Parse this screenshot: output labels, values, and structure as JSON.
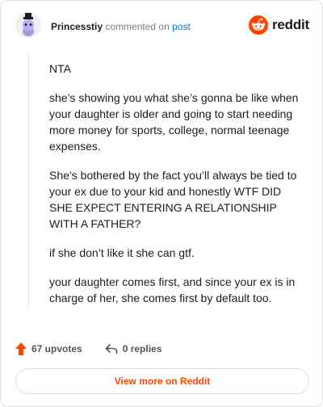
{
  "header": {
    "username": "Princesstiy",
    "action_text": "commented on",
    "post_link": "post",
    "brand": "reddit"
  },
  "comment": {
    "paragraphs": [
      "NTA",
      "she’s showing you what she’s gonna be like when your daughter is older and going to start needing more money for sports, college, normal teenage expenses.",
      "She’s bothered by the fact you’ll always be tied to your ex due to your kid and honestly WTF DID SHE EXPECT ENTERING A RELATIONSHIP WITH A FATHER?",
      "if she don’t like it she can gtf.",
      "your daughter comes first, and since your ex is in charge of her, she comes first by default too."
    ]
  },
  "footer": {
    "upvotes": "67 upvotes",
    "replies": "0 replies",
    "view_more": "View more on Reddit"
  },
  "colors": {
    "accent": "#ff4500",
    "link": "#0079d3",
    "avatar_purple": "#a89ad8"
  }
}
